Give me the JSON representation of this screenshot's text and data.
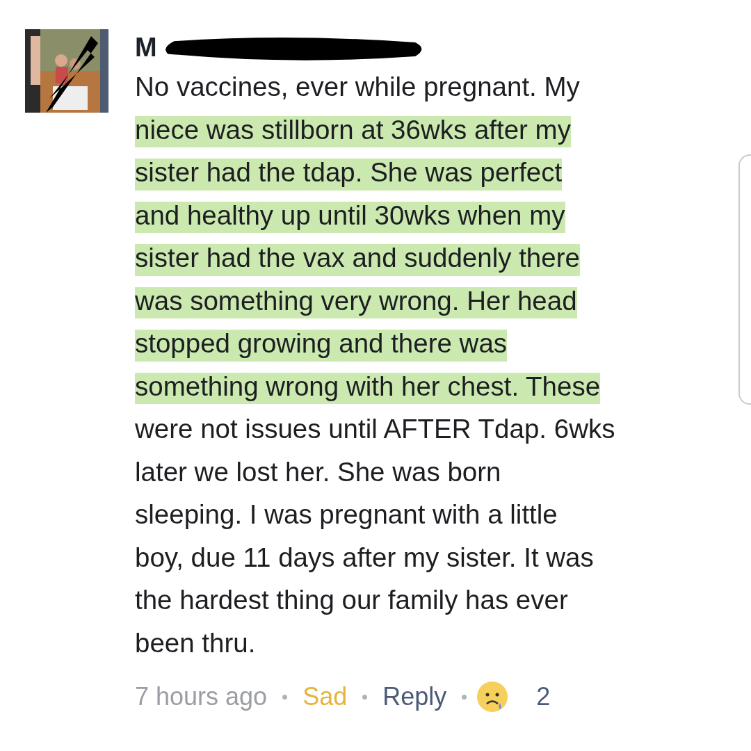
{
  "comment": {
    "author": "M",
    "lines": [
      {
        "text": "No vaccines, ever while pregnant. My",
        "highlighted": false
      },
      {
        "text": "niece was stillborn at 36wks after my",
        "highlighted": true
      },
      {
        "text": "sister had the tdap. She was perfect",
        "highlighted": true
      },
      {
        "text": "and healthy up until 30wks when my",
        "highlighted": true
      },
      {
        "text": "sister had the vax and suddenly there",
        "highlighted": true
      },
      {
        "text": "was something very wrong. Her head",
        "highlighted": true
      },
      {
        "text": "stopped growing and there was",
        "highlighted": true
      },
      {
        "text": "something wrong with her chest. These",
        "highlighted": true
      },
      {
        "text": "were not issues until AFTER Tdap. 6wks",
        "highlighted": false
      },
      {
        "text": "later we lost her. She was born",
        "highlighted": false
      },
      {
        "text": "sleeping. I was pregnant with a little",
        "highlighted": false
      },
      {
        "text": "boy, due 11 days after my sister. It was",
        "highlighted": false
      },
      {
        "text": "the hardest thing our family has ever",
        "highlighted": false
      },
      {
        "text": "been thru.",
        "highlighted": false
      }
    ],
    "time": "7 hours ago",
    "reaction": {
      "label": "Sad",
      "selected": true
    },
    "reply": "Reply",
    "reaction_count": "2"
  }
}
